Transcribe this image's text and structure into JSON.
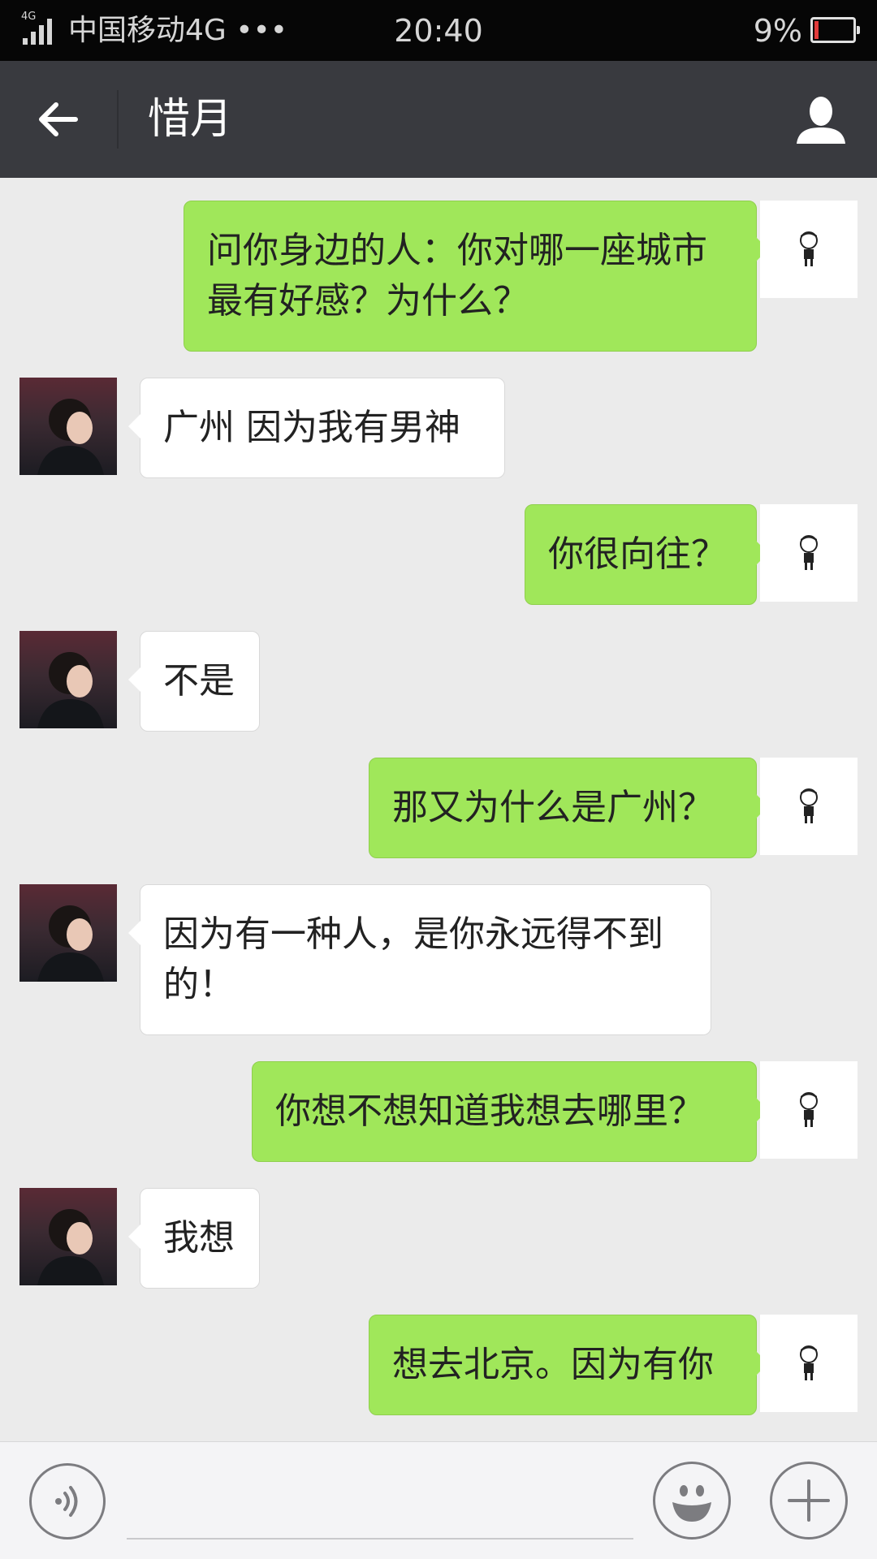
{
  "status_bar": {
    "network_type": "4G",
    "carrier": "中国移动4G •••",
    "time": "20:40",
    "battery_percent": "9%",
    "battery_level": 0.09,
    "battery_low_color": "#e23b3b"
  },
  "nav": {
    "back_icon": "arrow-left-icon",
    "title": "惜月",
    "profile_icon": "person-icon"
  },
  "messages": [
    {
      "direction": "sent",
      "text": "问你身边的人：你对哪一座城市最有好感？为什么？"
    },
    {
      "direction": "received",
      "text": "广州 因为我有男神"
    },
    {
      "direction": "sent",
      "text": "你很向往？"
    },
    {
      "direction": "received",
      "text": "不是"
    },
    {
      "direction": "sent",
      "text": "那又为什么是广州？"
    },
    {
      "direction": "received",
      "text": "因为有一种人，是你永远得不到的！"
    },
    {
      "direction": "sent",
      "text": "你想不想知道我想去哪里？"
    },
    {
      "direction": "received",
      "text": "我想"
    },
    {
      "direction": "sent",
      "text": "想去北京。因为有你"
    }
  ],
  "colors": {
    "sent_bubble": "#a0e75a",
    "received_bubble": "#ffffff",
    "nav_background": "#393a3f",
    "chat_background": "#ebebeb"
  },
  "input_bar": {
    "voice_icon": "voice-icon",
    "input_value": "",
    "emoji_icon": "emoji-icon",
    "plus_icon": "plus-icon"
  }
}
